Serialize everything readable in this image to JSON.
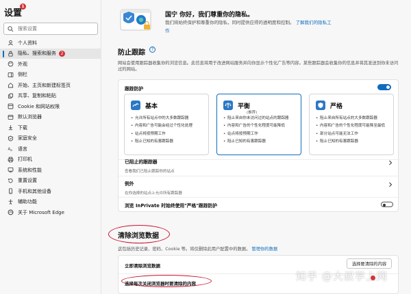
{
  "sidebar": {
    "title": "设置",
    "title_badge": "1",
    "search_placeholder": "搜索设置",
    "items": [
      {
        "label": "个人资料",
        "icon": "person-icon"
      },
      {
        "label": "隐私、搜索和服务",
        "icon": "lock-icon",
        "active": true,
        "badge": "2"
      },
      {
        "label": "外观",
        "icon": "appearance-icon"
      },
      {
        "label": "侧栏",
        "icon": "sidebar-icon"
      },
      {
        "label": "开始、主页和新建标签页",
        "icon": "home-icon"
      },
      {
        "label": "共享、复制和粘贴",
        "icon": "share-icon"
      },
      {
        "label": "Cookie 和网站权限",
        "icon": "cookie-icon"
      },
      {
        "label": "默认浏览器",
        "icon": "browser-icon"
      },
      {
        "label": "下载",
        "icon": "download-icon"
      },
      {
        "label": "家庭安全",
        "icon": "family-icon"
      },
      {
        "label": "语言",
        "icon": "language-icon"
      },
      {
        "label": "打印机",
        "icon": "printer-icon"
      },
      {
        "label": "系统和性能",
        "icon": "system-icon"
      },
      {
        "label": "重置设置",
        "icon": "reset-icon"
      },
      {
        "label": "手机和其他设备",
        "icon": "phone-icon"
      },
      {
        "label": "辅助功能",
        "icon": "accessibility-icon"
      },
      {
        "label": "关于 Microsoft Edge",
        "icon": "edge-icon"
      }
    ]
  },
  "hero": {
    "title": "国宁 你好，我们尊重你的隐私。",
    "subtitle": "我们将始终保护和尊重你的隐私，同时提供应得的透明度和控制。",
    "link": "了解我们的隐私工",
    "link_cont": "作"
  },
  "tracking": {
    "title": "防止跟踪",
    "help": "?",
    "description": "网站会使用跟踪器收集你的浏览信息。此信息将用于改进网站服务并向你显示个性化广告等内容。某些跟踪器会收集你的信息并将其发送到你未访问过的网站。",
    "toggle_label": "跟踪防护",
    "toggle_on": true,
    "modes": [
      {
        "name": "基本",
        "recommended": "",
        "selected": false,
        "bullets": [
          "允许所有站点中的大多数跟踪器",
          "内容和广告可能会经过个性化处理",
          "站点将按预期工作",
          "阻止已知的有害跟踪器"
        ]
      },
      {
        "name": "平衡",
        "recommended": "(推荐)",
        "selected": true,
        "bullets": [
          "阻止来自你未访问过的站点的跟踪器",
          "内容和广告的个性化程度可能降低",
          "站点将按预期工作",
          "阻止已知的有害跟踪器"
        ]
      },
      {
        "name": "严格",
        "recommended": "",
        "selected": false,
        "bullets": [
          "阻止来自所有站点的大多数跟踪器",
          "内容和广告的个性化程度可能降至最低",
          "部分站点可能无法工作",
          "阻止已知的有害跟踪器"
        ]
      }
    ],
    "blocked": {
      "title": "已阻止的跟踪器",
      "desc": "查看我们已阻止跟踪你的站点"
    },
    "exceptions": {
      "title": "例外",
      "desc": "在你选择的站点上允许所有跟踪器"
    },
    "inprivate": {
      "title": "浏览 InPrivate 时始终使用\"严格\"跟踪防护",
      "on": false
    }
  },
  "clear": {
    "title": "清除浏览数据",
    "desc": "这包括历史记录、密码、Cookie 等。将仅删除此用户配置中的数据。",
    "desc_link": "管理你的数据",
    "now_label": "立即清除浏览数据",
    "choose_button": "选择要清除的内容",
    "on_exit_label": "选择每次关闭浏览器时要清除的内容"
  },
  "watermark": "知乎 @大叔学上网",
  "colors": {
    "accent": "#0f6cbd",
    "badge": "#d13438",
    "annotation": "#c8102e"
  }
}
